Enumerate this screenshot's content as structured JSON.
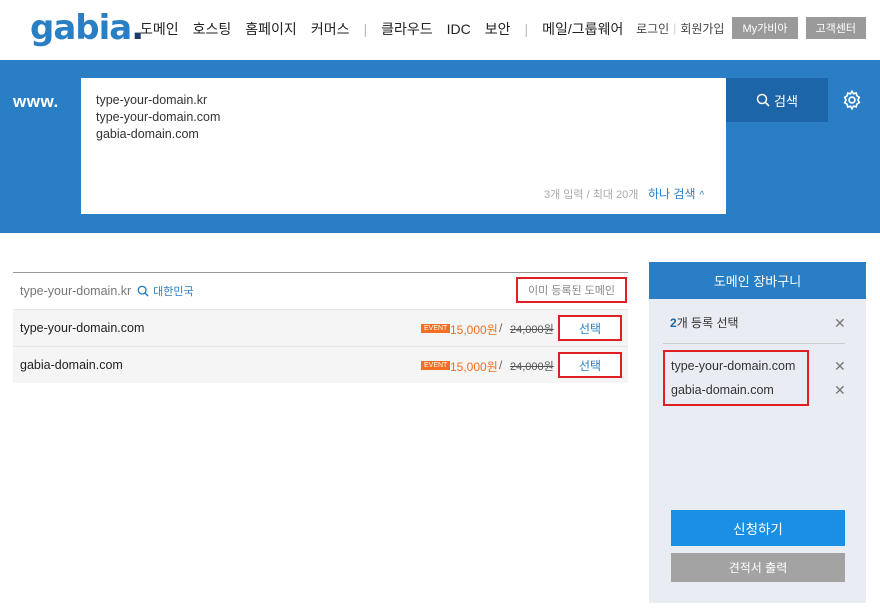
{
  "header": {
    "logo": "gabia",
    "logo_dot": ".",
    "nav": [
      "도메인",
      "호스팅",
      "홈페이지",
      "커머스",
      "클라우드",
      "IDC",
      "보안",
      "메일/그룹웨어"
    ],
    "login": "로그인",
    "signup": "회원가입",
    "mygabia": "My가비아",
    "support": "고객센터"
  },
  "search": {
    "prefix": "www.",
    "lines": [
      "type-your-domain.kr",
      "type-your-domain.com",
      "gabia-domain.com"
    ],
    "count_text": "3개 입력 / 최대 20개",
    "single_search": "하나 검색",
    "button": "검색"
  },
  "results": {
    "query_domain": "type-your-domain.kr",
    "query_country": "대한민국",
    "registered_label": "이미 등록된 도메인",
    "rows": [
      {
        "domain": "type-your-domain.com",
        "event": "EVENT",
        "price": "15,000원",
        "original": "24,000원",
        "select": "선택"
      },
      {
        "domain": "gabia-domain.com",
        "event": "EVENT",
        "price": "15,000원",
        "original": "24,000원",
        "select": "선택"
      }
    ]
  },
  "cart": {
    "title": "도메인 장바구니",
    "count_num": "2",
    "count_text": "개 등록 선택",
    "items": [
      "type-your-domain.com",
      "gabia-domain.com"
    ],
    "apply": "신청하기",
    "quote": "견적서 출력"
  },
  "colors": {
    "brand_blue": "#2a7fc4",
    "search_button": "#1c65a8",
    "event_orange": "#f36f21",
    "highlight_red": "#e02020",
    "apply_blue": "#1a8fe3"
  }
}
